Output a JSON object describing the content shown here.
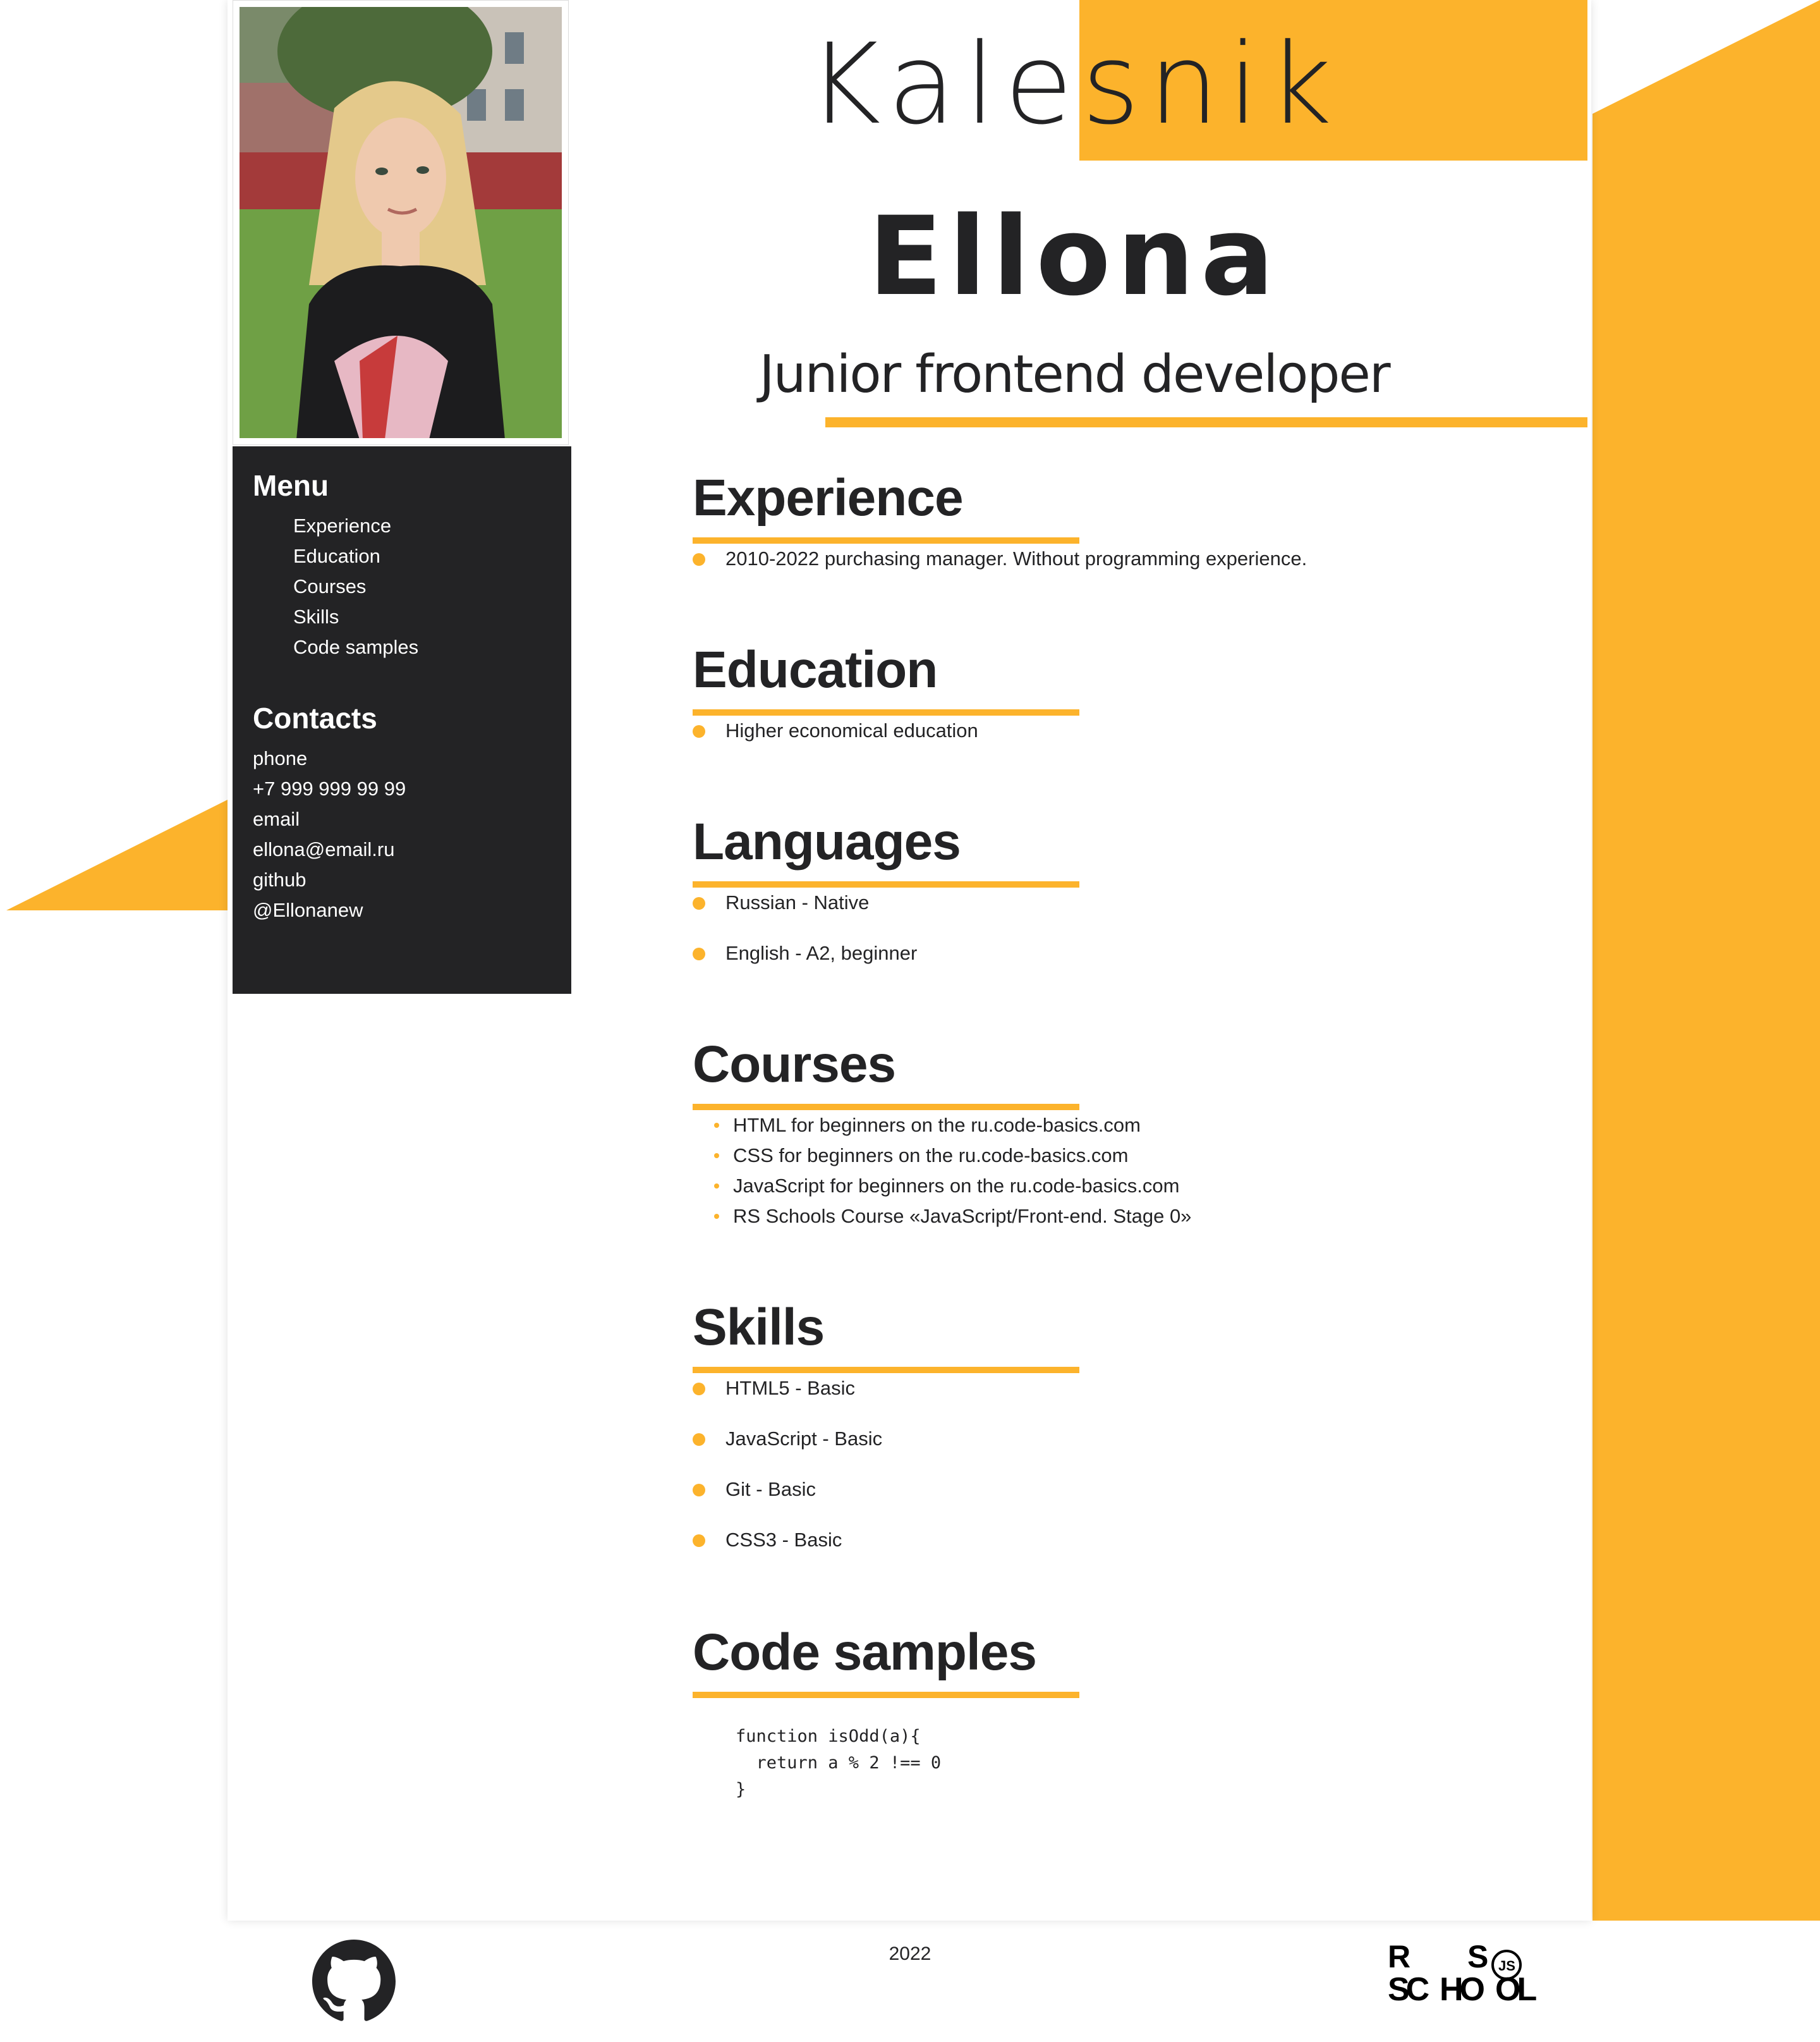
{
  "header": {
    "last_name": "Kalesnik",
    "first_name": "Ellona",
    "position": "Junior frontend developer"
  },
  "sidebar": {
    "menu_title": "Menu",
    "menu_items": [
      {
        "label": "Experience"
      },
      {
        "label": "Education"
      },
      {
        "label": "Courses"
      },
      {
        "label": "Skills"
      },
      {
        "label": "Code samples"
      }
    ],
    "contacts_title": "Contacts",
    "contacts": [
      {
        "text": "phone"
      },
      {
        "text": "+7 999 999 99 99"
      },
      {
        "text": "email"
      },
      {
        "text": "ellona@email.ru"
      },
      {
        "text": "github"
      },
      {
        "text": "@Ellonanew"
      }
    ]
  },
  "sections": {
    "experience": {
      "title": "Experience",
      "items": [
        "2010-2022 purchasing manager. Without programming experience."
      ]
    },
    "education": {
      "title": "Education",
      "items": [
        "Higher economical education"
      ]
    },
    "languages": {
      "title": "Languages",
      "items": [
        "Russian - Native",
        "English - A2, beginner"
      ]
    },
    "courses": {
      "title": "Courses",
      "items": [
        "HTML for beginners on the ru.code-basics.com",
        "CSS for beginners on the ru.code-basics.com",
        "JavaScript for beginners on the ru.code-basics.com",
        "RS Schools Course «JavaScript/Front-end. Stage 0»"
      ]
    },
    "skills": {
      "title": "Skills",
      "items": [
        "HTML5 - Basic",
        "JavaScript - Basic",
        "Git - Basic",
        "CSS3 - Basic"
      ]
    },
    "code_samples": {
      "title": "Code samples",
      "code": "function isOdd(a){\n  return a % 2 !== 0\n}"
    }
  },
  "footer": {
    "year": "2022",
    "github_icon": "github-icon",
    "school_logo_text": "RS SCHOOL JS"
  },
  "colors": {
    "accent": "#fcb32c",
    "dark": "#232325",
    "background": "#ffffff"
  }
}
